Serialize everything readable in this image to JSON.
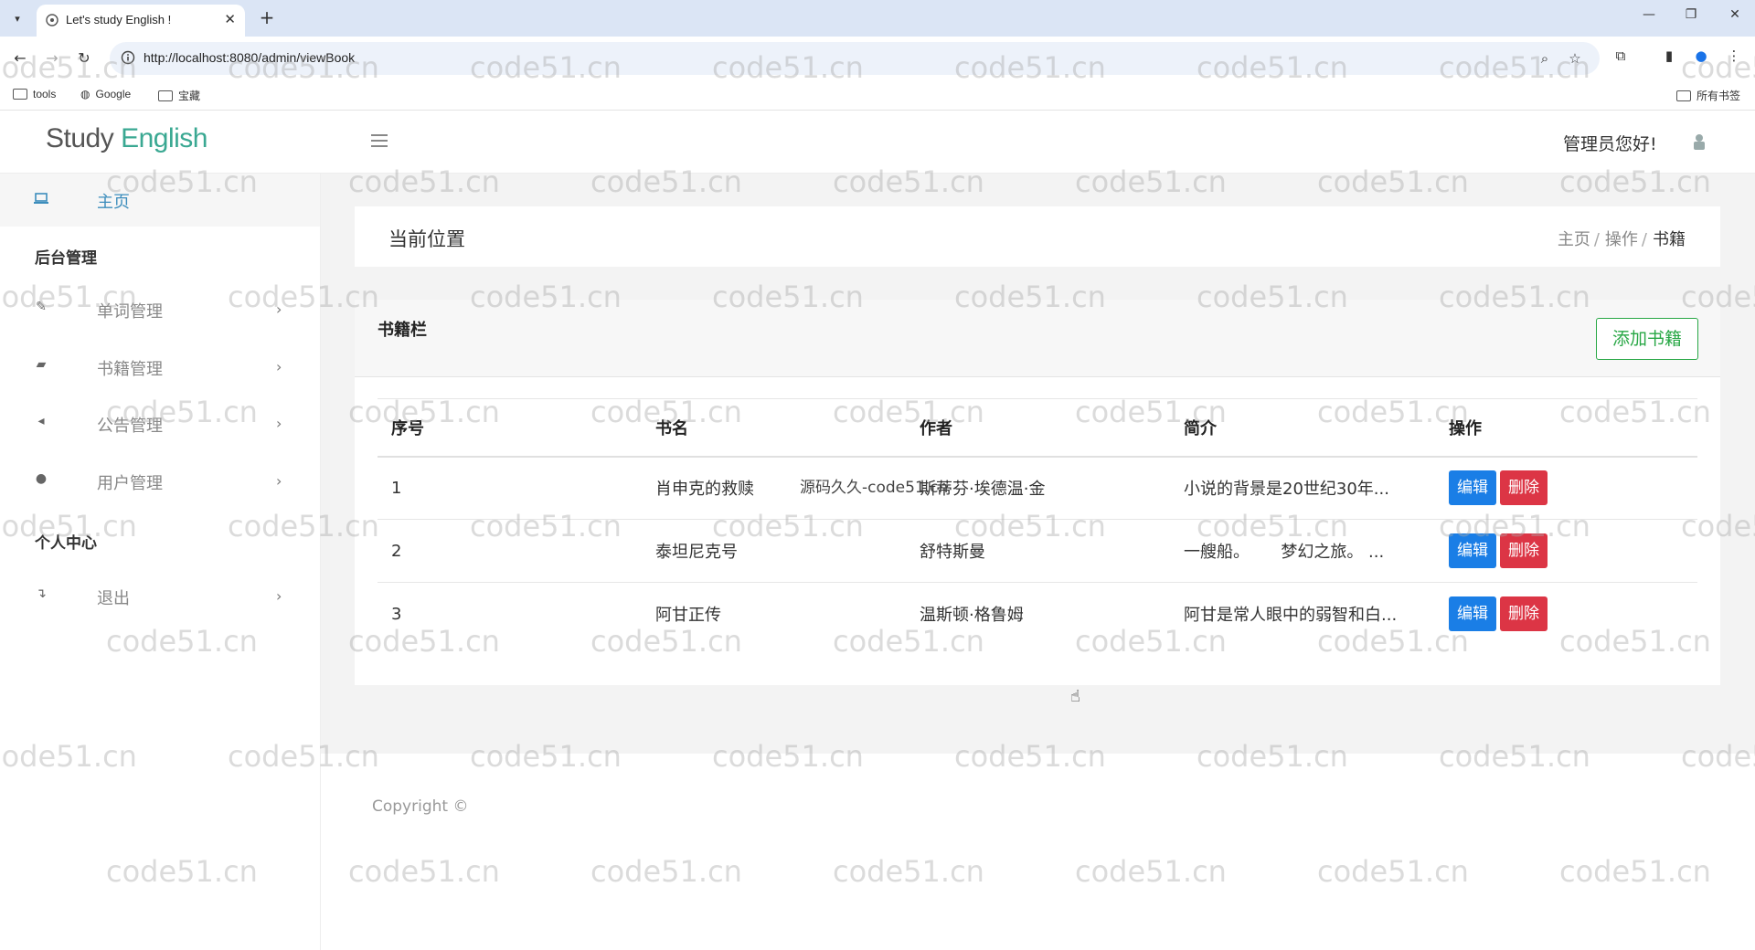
{
  "browser": {
    "tab_title": "Let's study English !",
    "url": "http://localhost:8080/admin/viewBook",
    "bookmarks": [
      "tools",
      "Google",
      "宝藏"
    ],
    "all_bookmarks": "所有书签"
  },
  "header": {
    "logo_part1": "Study",
    "logo_part2": "English",
    "greeting": "管理员您好!"
  },
  "sidebar": {
    "home": "主页",
    "section_admin": "后台管理",
    "items": [
      {
        "label": "单词管理",
        "icon": "edit-icon"
      },
      {
        "label": "书籍管理",
        "icon": "book-icon"
      },
      {
        "label": "公告管理",
        "icon": "volume-icon"
      },
      {
        "label": "用户管理",
        "icon": "user-icon"
      }
    ],
    "section_personal": "个人中心",
    "logout": "退出"
  },
  "breadcrumb": {
    "title": "当前位置",
    "items": [
      "主页",
      "操作",
      "书籍"
    ]
  },
  "table_card": {
    "title": "书籍栏",
    "add_button": "添加书籍",
    "columns": [
      "序号",
      "书名",
      "作者",
      "简介",
      "操作"
    ],
    "rows": [
      {
        "id": "1",
        "name": "肖申克的救赎",
        "author": "斯蒂芬·埃德温·金",
        "intro": "小说的背景是20世纪30年..."
      },
      {
        "id": "2",
        "name": "泰坦尼克号",
        "author": "舒特斯曼",
        "intro": "一艘船。      梦幻之旅。 ..."
      },
      {
        "id": "3",
        "name": "阿甘正传",
        "author": "温斯顿·格鲁姆",
        "intro": "阿甘是常人眼中的弱智和白..."
      }
    ],
    "edit_label": "编辑",
    "delete_label": "删除",
    "overlay": "源码久久-code51.cn"
  },
  "footer": {
    "copyright": "Copyright ©"
  },
  "watermark": "code51.cn"
}
